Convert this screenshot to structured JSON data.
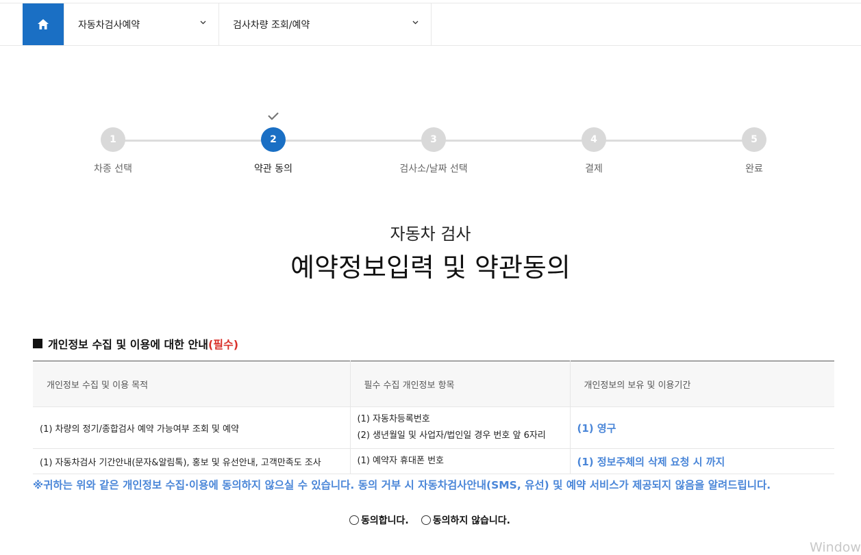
{
  "nav": {
    "dropdown1": "자동차검사예약",
    "dropdown2": "검사차량 조회/예약"
  },
  "steps": [
    {
      "num": "1",
      "label": "차종 선택"
    },
    {
      "num": "2",
      "label": "약관 동의"
    },
    {
      "num": "3",
      "label": "검사소/날짜 선택"
    },
    {
      "num": "4",
      "label": "결제"
    },
    {
      "num": "5",
      "label": "완료"
    }
  ],
  "page": {
    "subtitle": "자동차 검사",
    "title": "예약정보입력 및 약관동의"
  },
  "section": {
    "heading": "개인정보 수집 및 이용에 대한 안내",
    "required": "(필수)"
  },
  "table": {
    "headers": [
      "개인정보 수집 및 이용 목적",
      "필수 수집 개인정보 항목",
      "개인정보의 보유 및 이용기간"
    ],
    "rows": [
      {
        "purpose": "(1) 차량의 정기/종합검사 예약 가능여부 조회 및 예약",
        "items": [
          "(1) 자동차등록번호",
          "(2) 생년월일 및 사업자/법인일 경우 번호 앞 6자리"
        ],
        "period": "(1) 영구"
      },
      {
        "purpose": "(1) 자동차검사 기간안내(문자&알림톡), 홍보 및 유선안내, 고객만족도 조사",
        "items": [
          "(1) 예약자 휴대폰 번호"
        ],
        "period": "(1) 정보주체의 삭제 요청 시 까지"
      }
    ]
  },
  "notice": "※귀하는 위와 같은 개인정보 수집·이용에 동의하지 않으실 수 있습니다. 동의 거부 시 자동차검사안내(SMS, 유선) 및 예약 서비스가 제공되지 않음을 알려드립니다.",
  "agree": {
    "yes": "동의합니다.",
    "no": "동의하지 않습니다."
  },
  "watermark": "Window",
  "colors": {
    "brand": "#1a6fc4",
    "info_blue": "#4a86d8",
    "required_red": "#d9322b"
  },
  "current_step": 2
}
